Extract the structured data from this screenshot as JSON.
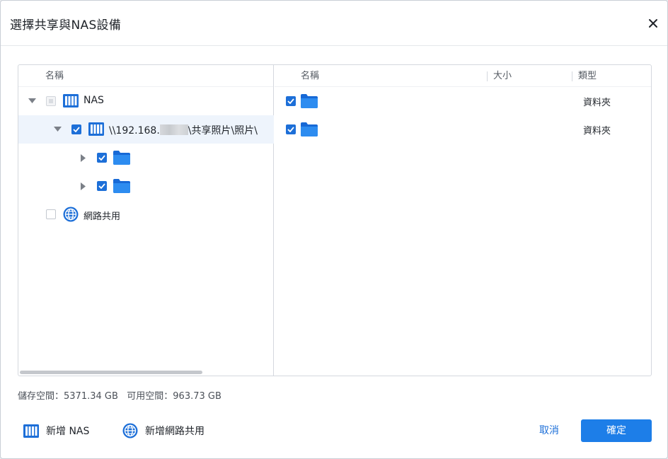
{
  "dialog": {
    "title": "選擇共享與NAS設備"
  },
  "left_pane": {
    "column_name": "名稱",
    "tree": [
      {
        "label": "NAS",
        "state": "partial",
        "expanded": true,
        "icon": "nas-icon"
      },
      {
        "label_prefix": "\\\\192.168.",
        "label_suffix": "\\共享照片\\照片\\",
        "state": "checked",
        "expanded": true,
        "icon": "nas-icon",
        "selected": true
      },
      {
        "label": "",
        "state": "checked",
        "expanded": false,
        "icon": "folder-icon"
      },
      {
        "label": "",
        "state": "checked",
        "expanded": false,
        "icon": "folder-icon"
      },
      {
        "label": "網路共用",
        "state": "unchecked",
        "icon": "globe-icon"
      }
    ]
  },
  "right_pane": {
    "columns": {
      "name": "名稱",
      "size": "大小",
      "type": "類型"
    },
    "rows": [
      {
        "name": "",
        "size": "",
        "type": "資料夾",
        "checked": true,
        "icon": "folder-icon"
      },
      {
        "name": "",
        "size": "",
        "type": "資料夾",
        "checked": true,
        "icon": "folder-icon"
      }
    ]
  },
  "storage": {
    "text": "儲存空間：5371.34 GB   可用空間：963.73 GB"
  },
  "footer": {
    "add_nas": "新增 NAS",
    "add_network_share": "新增網路共用",
    "cancel": "取消",
    "ok": "確定"
  },
  "colors": {
    "accent": "#1d7ee8",
    "folder": "#1e88ff",
    "selected_row": "#eef4fc"
  }
}
